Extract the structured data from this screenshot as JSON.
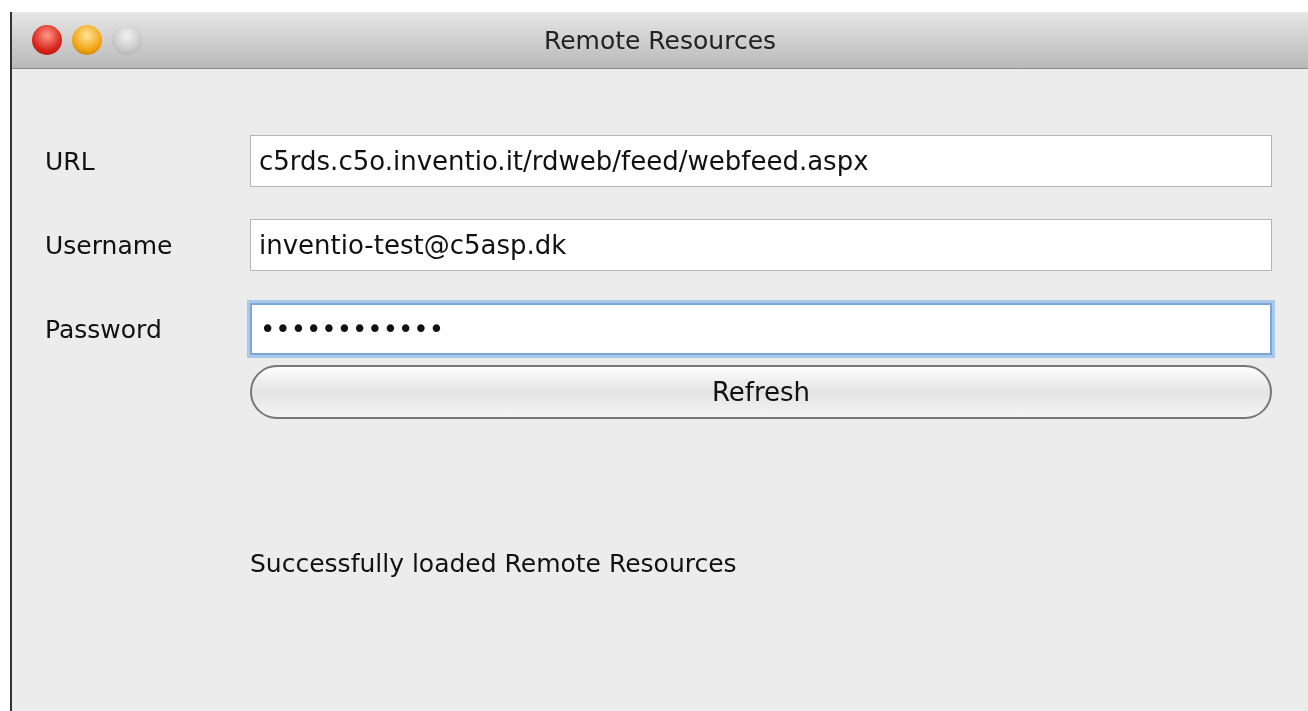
{
  "window": {
    "title": "Remote Resources"
  },
  "fields": [
    {
      "label": "URL",
      "value": "c5rds.c5o.inventio.it/rdweb/feed/webfeed.aspx",
      "focused": false
    },
    {
      "label": "Username",
      "value": "inventio-test@c5asp.dk",
      "focused": false
    },
    {
      "label": "Password",
      "value": "••••••••••••",
      "focused": true
    }
  ],
  "button": {
    "label": "Refresh"
  },
  "status": "Successfully loaded Remote Resources"
}
